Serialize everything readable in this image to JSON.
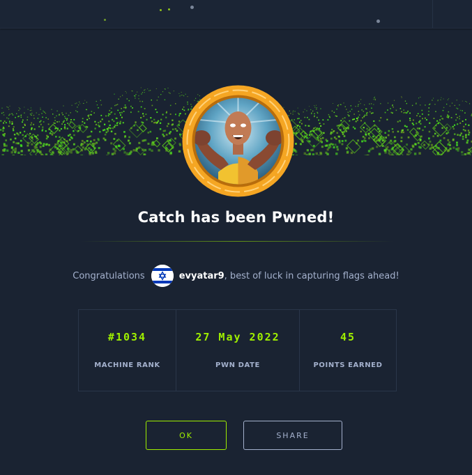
{
  "dialog": {
    "title": "Catch has been Pwned!",
    "congrats_prefix": "Congratulations",
    "username": "evyatar9",
    "congrats_suffix": ", best of luck in capturing flags ahead!",
    "flag_icon": "israel-flag-icon",
    "avatar_icon": "pwned-mascot-avatar"
  },
  "stats": [
    {
      "value": "#1034",
      "label": "MACHINE RANK"
    },
    {
      "value": "27 May 2022",
      "label": "PWN DATE"
    },
    {
      "value": "45",
      "label": "POINTS EARNED"
    }
  ],
  "buttons": {
    "ok_label": "OK",
    "share_label": "SHARE"
  },
  "colors": {
    "background": "#1a2332",
    "accent": "#9fef00",
    "muted_text": "#a4b1cd",
    "avatar_ring": "#f5a623"
  }
}
